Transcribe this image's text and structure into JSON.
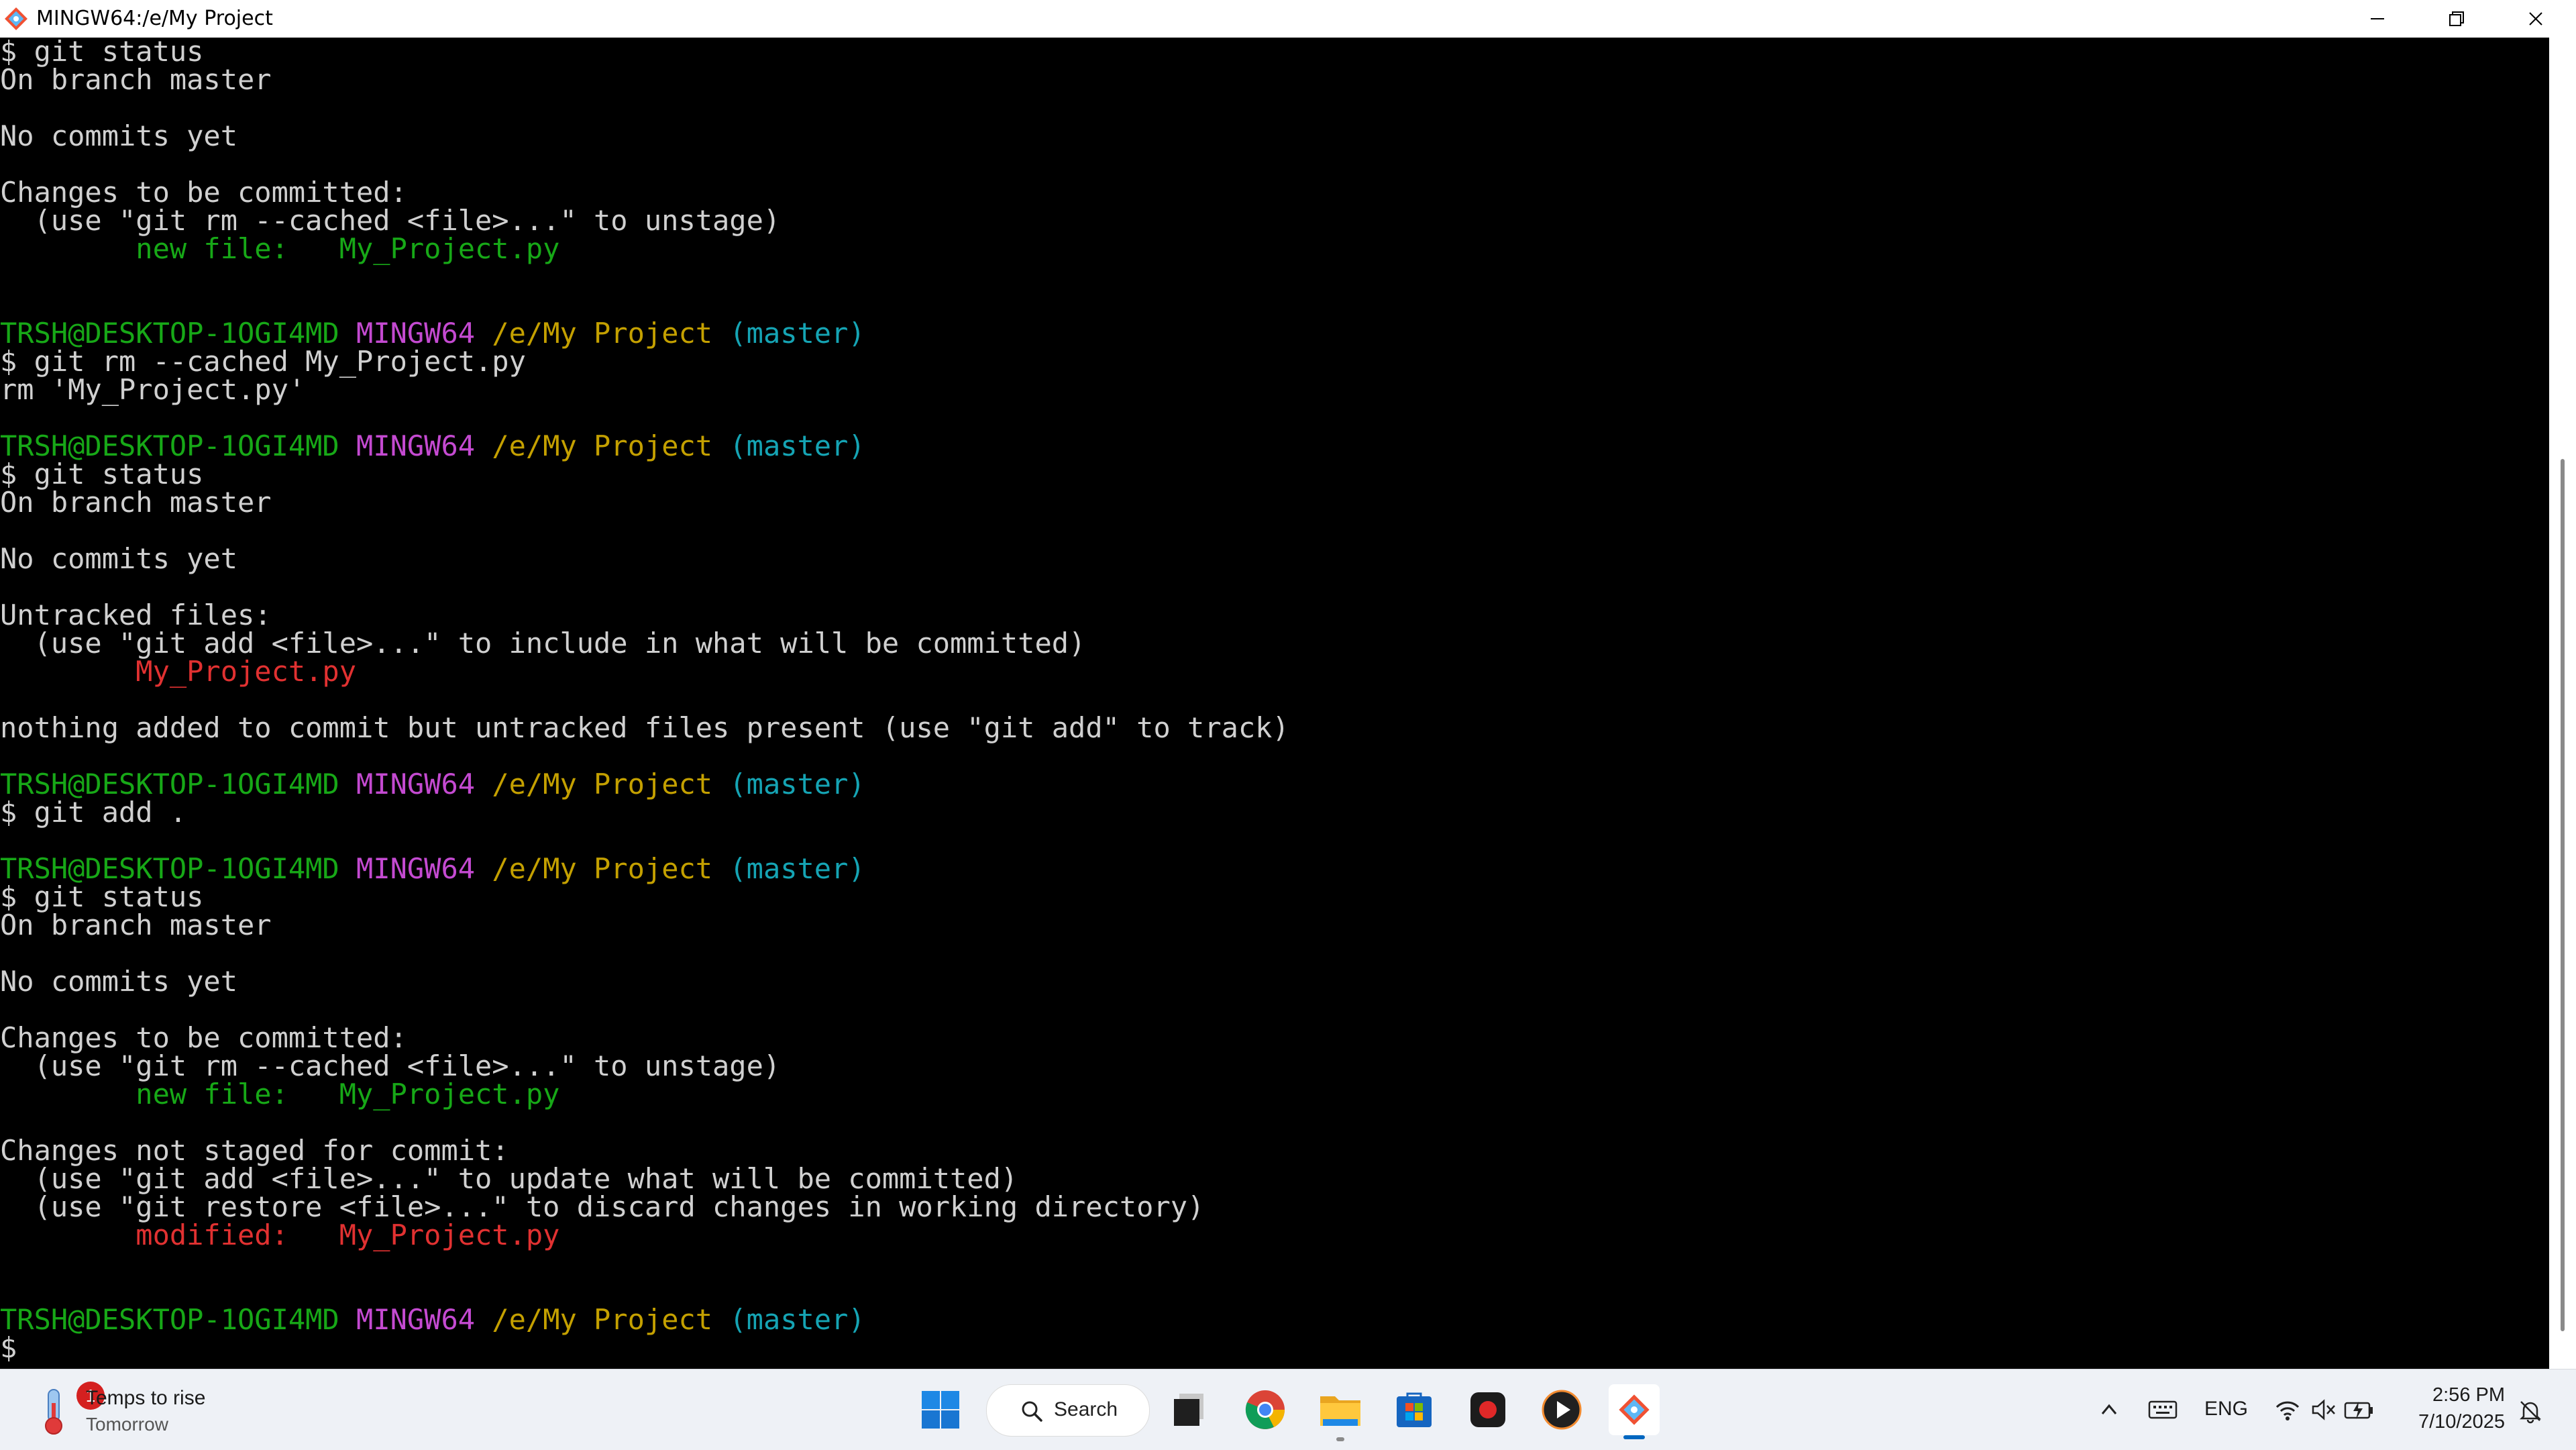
{
  "window": {
    "title": "MINGW64:/e/My Project",
    "minimize_icon": "minimize-icon",
    "maximize_icon": "restore-icon",
    "close_icon": "close-icon"
  },
  "colors": {
    "prompt_user": "#17a817",
    "prompt_shell": "#c44ad1",
    "prompt_path": "#c4a000",
    "prompt_branch": "#15a4b4",
    "staged": "#17a817",
    "unstaged": "#e13131"
  },
  "terminal": {
    "lines": [
      [
        {
          "t": "$ git status",
          "c": "white"
        }
      ],
      [
        {
          "t": "On branch master",
          "c": "white"
        }
      ],
      [],
      [
        {
          "t": "No commits yet",
          "c": "white"
        }
      ],
      [],
      [
        {
          "t": "Changes to be committed:",
          "c": "white"
        }
      ],
      [
        {
          "t": "  (use \"git rm --cached <file>...\" to unstage)",
          "c": "white"
        }
      ],
      [
        {
          "t": "        new file:   My_Project.py",
          "c": "green"
        }
      ],
      [],
      [],
      [
        {
          "t": "TRSH@DESKTOP-1OGI4MD",
          "c": "green"
        },
        {
          "t": " ",
          "c": "white"
        },
        {
          "t": "MINGW64",
          "c": "magenta"
        },
        {
          "t": " ",
          "c": "white"
        },
        {
          "t": "/e/My Project",
          "c": "yellow"
        },
        {
          "t": " ",
          "c": "white"
        },
        {
          "t": "(master)",
          "c": "cyan"
        }
      ],
      [
        {
          "t": "$ git rm --cached My_Project.py",
          "c": "white"
        }
      ],
      [
        {
          "t": "rm 'My_Project.py'",
          "c": "white"
        }
      ],
      [],
      [
        {
          "t": "TRSH@DESKTOP-1OGI4MD",
          "c": "green"
        },
        {
          "t": " ",
          "c": "white"
        },
        {
          "t": "MINGW64",
          "c": "magenta"
        },
        {
          "t": " ",
          "c": "white"
        },
        {
          "t": "/e/My Project",
          "c": "yellow"
        },
        {
          "t": " ",
          "c": "white"
        },
        {
          "t": "(master)",
          "c": "cyan"
        }
      ],
      [
        {
          "t": "$ git status",
          "c": "white"
        }
      ],
      [
        {
          "t": "On branch master",
          "c": "white"
        }
      ],
      [],
      [
        {
          "t": "No commits yet",
          "c": "white"
        }
      ],
      [],
      [
        {
          "t": "Untracked files:",
          "c": "white"
        }
      ],
      [
        {
          "t": "  (use \"git add <file>...\" to include in what will be committed)",
          "c": "white"
        }
      ],
      [
        {
          "t": "        My_Project.py",
          "c": "red"
        }
      ],
      [],
      [
        {
          "t": "nothing added to commit but untracked files present (use \"git add\" to track)",
          "c": "white"
        }
      ],
      [],
      [
        {
          "t": "TRSH@DESKTOP-1OGI4MD",
          "c": "green"
        },
        {
          "t": " ",
          "c": "white"
        },
        {
          "t": "MINGW64",
          "c": "magenta"
        },
        {
          "t": " ",
          "c": "white"
        },
        {
          "t": "/e/My Project",
          "c": "yellow"
        },
        {
          "t": " ",
          "c": "white"
        },
        {
          "t": "(master)",
          "c": "cyan"
        }
      ],
      [
        {
          "t": "$ git add .",
          "c": "white"
        }
      ],
      [],
      [
        {
          "t": "TRSH@DESKTOP-1OGI4MD",
          "c": "green"
        },
        {
          "t": " ",
          "c": "white"
        },
        {
          "t": "MINGW64",
          "c": "magenta"
        },
        {
          "t": " ",
          "c": "white"
        },
        {
          "t": "/e/My Project",
          "c": "yellow"
        },
        {
          "t": " ",
          "c": "white"
        },
        {
          "t": "(master)",
          "c": "cyan"
        }
      ],
      [
        {
          "t": "$ git status",
          "c": "white"
        }
      ],
      [
        {
          "t": "On branch master",
          "c": "white"
        }
      ],
      [],
      [
        {
          "t": "No commits yet",
          "c": "white"
        }
      ],
      [],
      [
        {
          "t": "Changes to be committed:",
          "c": "white"
        }
      ],
      [
        {
          "t": "  (use \"git rm --cached <file>...\" to unstage)",
          "c": "white"
        }
      ],
      [
        {
          "t": "        new file:   My_Project.py",
          "c": "green"
        }
      ],
      [],
      [
        {
          "t": "Changes not staged for commit:",
          "c": "white"
        }
      ],
      [
        {
          "t": "  (use \"git add <file>...\" to update what will be committed)",
          "c": "white"
        }
      ],
      [
        {
          "t": "  (use \"git restore <file>...\" to discard changes in working directory)",
          "c": "white"
        }
      ],
      [
        {
          "t": "        modified:   My_Project.py",
          "c": "red"
        }
      ],
      [],
      [],
      [
        {
          "t": "TRSH@DESKTOP-1OGI4MD",
          "c": "green"
        },
        {
          "t": " ",
          "c": "white"
        },
        {
          "t": "MINGW64",
          "c": "magenta"
        },
        {
          "t": " ",
          "c": "white"
        },
        {
          "t": "/e/My Project",
          "c": "yellow"
        },
        {
          "t": " ",
          "c": "white"
        },
        {
          "t": "(master)",
          "c": "cyan"
        }
      ],
      [
        {
          "t": "$",
          "c": "white"
        }
      ]
    ]
  },
  "taskbar": {
    "weather": {
      "title": "Temps to rise",
      "subtitle": "Tomorrow",
      "badge": "1",
      "icon": "thermometer-icon"
    },
    "search_label": "Search",
    "apps": [
      {
        "name": "start-button",
        "icon": "windows-logo-icon"
      },
      {
        "name": "task-view-button",
        "icon": "task-view-icon"
      },
      {
        "name": "chrome-button",
        "icon": "chrome-icon"
      },
      {
        "name": "file-explorer-button",
        "icon": "folder-icon"
      },
      {
        "name": "microsoft-store-button",
        "icon": "store-icon"
      },
      {
        "name": "screen-recorder-button",
        "icon": "record-icon"
      },
      {
        "name": "media-player-button",
        "icon": "play-icon"
      },
      {
        "name": "git-bash-button",
        "icon": "git-icon"
      }
    ],
    "tray": {
      "language": "ENG",
      "time": "2:56 PM",
      "date": "7/10/2025",
      "icons": [
        "chevron-up-icon",
        "keyboard-icon",
        "wifi-icon",
        "volume-muted-icon",
        "battery-charging-icon",
        "notification-icon"
      ]
    }
  }
}
